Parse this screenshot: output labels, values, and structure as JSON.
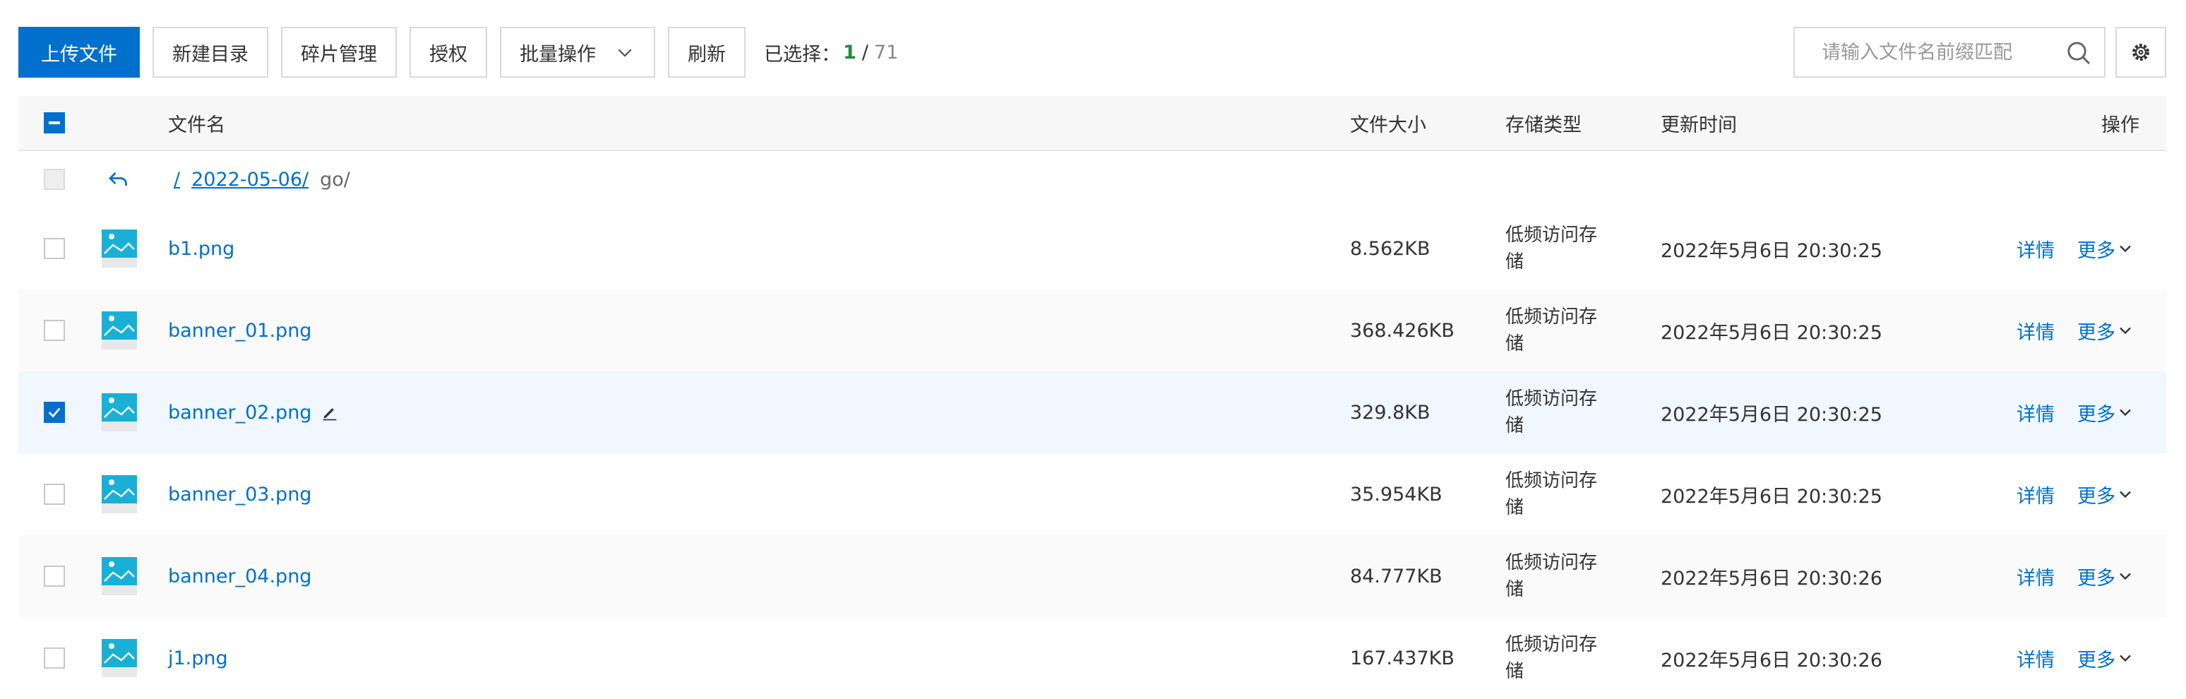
{
  "toolbar": {
    "upload_label": "上传文件",
    "new_dir_label": "新建目录",
    "fragment_label": "碎片管理",
    "auth_label": "授权",
    "batch_label": "批量操作",
    "refresh_label": "刷新",
    "selected_prefix": "已选择：",
    "selected_count": "1",
    "selected_total": "71"
  },
  "search": {
    "placeholder": "请输入文件名前缀匹配"
  },
  "colors": {
    "primary": "#0070cc",
    "selected_count": "#1e8e3e",
    "header_bg": "#f7f7f7",
    "selected_row_bg": "#f0f7fe"
  },
  "table": {
    "headers": {
      "name": "文件名",
      "size": "文件大小",
      "storage": "存储类型",
      "updated": "更新时间",
      "actions": "操作"
    },
    "nav": {
      "root": "/",
      "parent": "2022-05-06/",
      "current": "go/"
    },
    "detail_label": "详情",
    "more_label": "更多",
    "rows": [
      {
        "name": "b1.png",
        "size": "8.562KB",
        "storage": "低频访问存储",
        "updated": "2022年5月6日 20:30:25"
      },
      {
        "name": "banner_01.png",
        "size": "368.426KB",
        "storage": "低频访问存储",
        "updated": "2022年5月6日 20:30:25"
      },
      {
        "name": "banner_02.png",
        "size": "329.8KB",
        "storage": "低频访问存储",
        "updated": "2022年5月6日 20:30:25"
      },
      {
        "name": "banner_03.png",
        "size": "35.954KB",
        "storage": "低频访问存储",
        "updated": "2022年5月6日 20:30:25"
      },
      {
        "name": "banner_04.png",
        "size": "84.777KB",
        "storage": "低频访问存储",
        "updated": "2022年5月6日 20:30:26"
      },
      {
        "name": "j1.png",
        "size": "167.437KB",
        "storage": "低频访问存储",
        "updated": "2022年5月6日 20:30:26"
      }
    ]
  }
}
